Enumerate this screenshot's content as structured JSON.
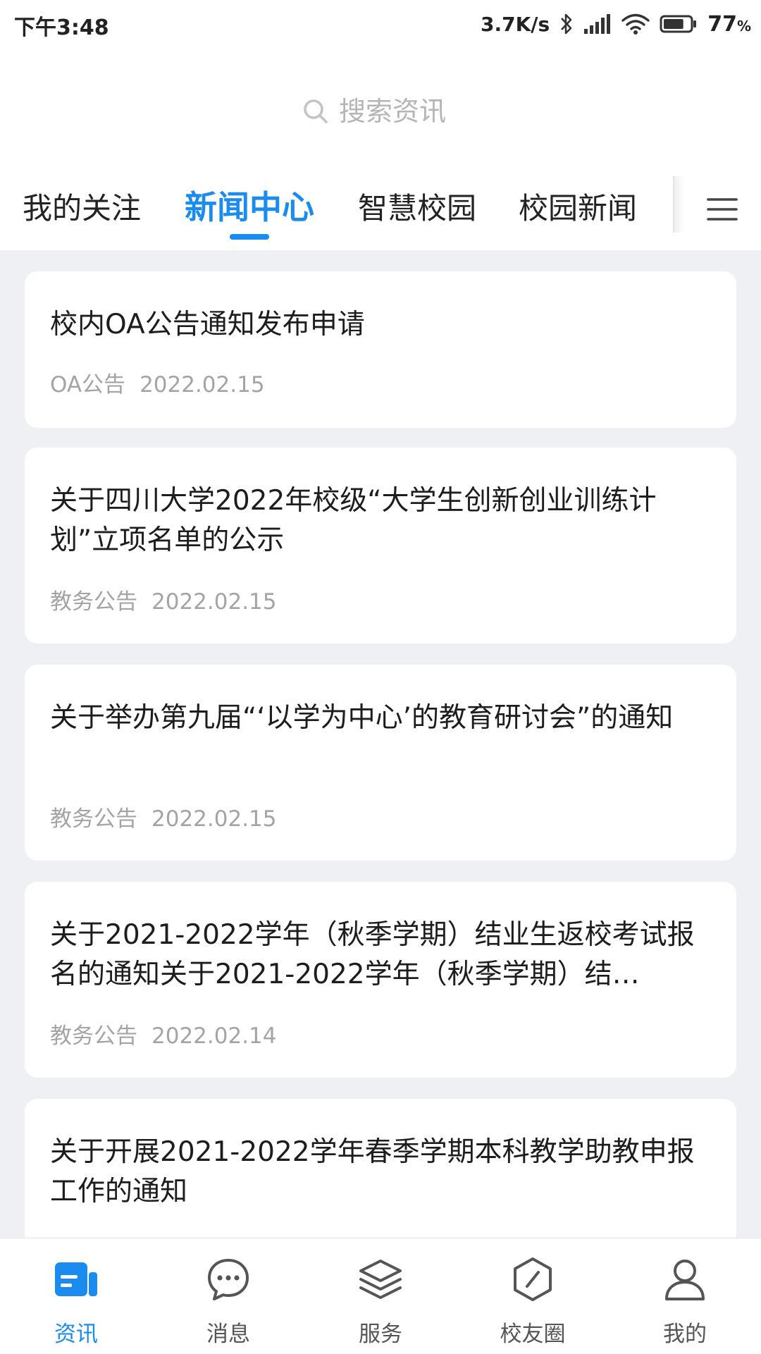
{
  "status_bar": {
    "time": "下午3:48",
    "network_speed": "3.7K/s",
    "battery": "77",
    "battery_unit": "%"
  },
  "search": {
    "placeholder": "搜索资讯"
  },
  "tabs": [
    {
      "label": "我的关注",
      "active": false
    },
    {
      "label": "新闻中心",
      "active": true
    },
    {
      "label": "智慧校园",
      "active": false
    },
    {
      "label": "校园新闻",
      "active": false
    }
  ],
  "news": [
    {
      "title": "校内OA公告通知发布申请",
      "category": "OA公告",
      "date": "2022.02.15"
    },
    {
      "title": "关于四川大学2022年校级“大学生创新创业训练计划”立项名单的公示",
      "category": "教务公告",
      "date": "2022.02.15"
    },
    {
      "title": "关于举办第九届“‘以学为中心’的教育研讨会”的通知",
      "category": "教务公告",
      "date": "2022.02.15"
    },
    {
      "title": "关于2021-2022学年（秋季学期）结业生返校考试报名的通知关于2021-2022学年（秋季学期）结…",
      "category": "教务公告",
      "date": "2022.02.14"
    },
    {
      "title": "关于开展2021-2022学年春季学期本科教学助教申报工作的通知",
      "category": "",
      "date": ""
    }
  ],
  "bottom_nav": [
    {
      "label": "资讯",
      "icon": "news-icon",
      "active": true
    },
    {
      "label": "消息",
      "icon": "message-icon",
      "active": false
    },
    {
      "label": "服务",
      "icon": "layers-icon",
      "active": false
    },
    {
      "label": "校友圈",
      "icon": "alumni-icon",
      "active": false
    },
    {
      "label": "我的",
      "icon": "profile-icon",
      "active": false
    }
  ],
  "colors": {
    "accent": "#1a8cf0",
    "background": "#eef0f3",
    "card": "#ffffff",
    "meta_text": "#a4a4a4"
  }
}
